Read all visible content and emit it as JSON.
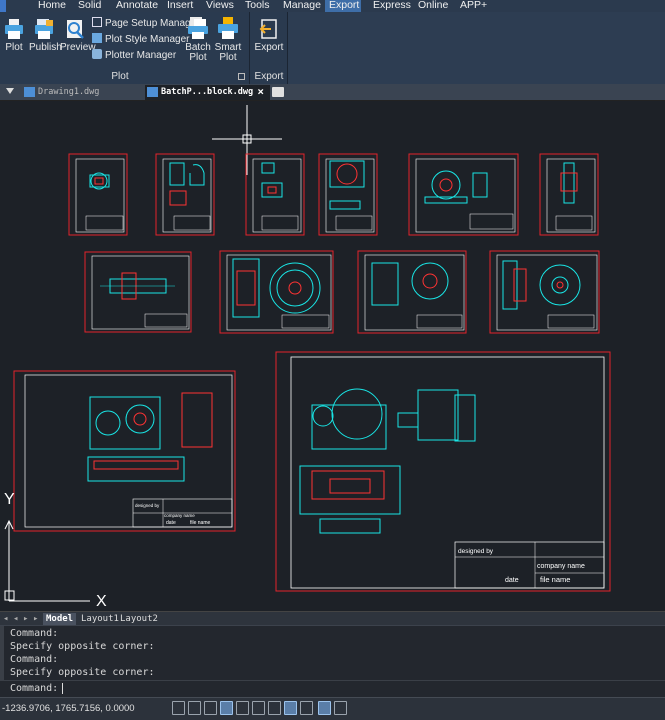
{
  "menubar": {
    "items": [
      "Home",
      "Solid",
      "Annotate",
      "Insert",
      "Views",
      "Tools",
      "Manage",
      "Export",
      "Express",
      "Online",
      "APP+"
    ],
    "active": "Export"
  },
  "ribbon": {
    "plot_group": {
      "title": "Plot",
      "plot": "Plot",
      "publish": "Publish",
      "preview": "Preview",
      "page_setup": "Page Setup Manager",
      "plot_style": "Plot Style Manager",
      "plotter": "Plotter Manager",
      "batch_plot_1": "Batch",
      "batch_plot_2": "Plot",
      "smart_plot_1": "Smart",
      "smart_plot_2": "Plot"
    },
    "export_group": {
      "title": "Export",
      "export": "Export"
    }
  },
  "doc_tabs": [
    {
      "label": "Drawing1.dwg",
      "active": false
    },
    {
      "label": "BatchP...block.dwg",
      "active": true
    }
  ],
  "layout_tabs": {
    "model": "Model",
    "layout1": "Layout1",
    "layout2": "Layout2"
  },
  "command": {
    "history": [
      "Command:",
      "Specify opposite corner:",
      "Command:",
      "Specify opposite corner:"
    ],
    "prompt": "Command:"
  },
  "status": {
    "coordinates": "-1236.9706, 1765.7156, 0.0000"
  },
  "canvas": {
    "axis_y": "Y",
    "axis_x": "X",
    "sheet1_title_block": {
      "designed": "designed by",
      "company": "company name",
      "date": "date",
      "file": "file name"
    },
    "sheet2_title_block": {
      "designed": "designed by",
      "company": "company name",
      "date": "date",
      "file": "file name"
    }
  },
  "colors": {
    "background": "#1d2127",
    "sheet_border": "#e3242b",
    "sheet_frame": "#ffffff",
    "geometry_cyan": "#19e5e5",
    "geometry_red": "#ff3333"
  }
}
